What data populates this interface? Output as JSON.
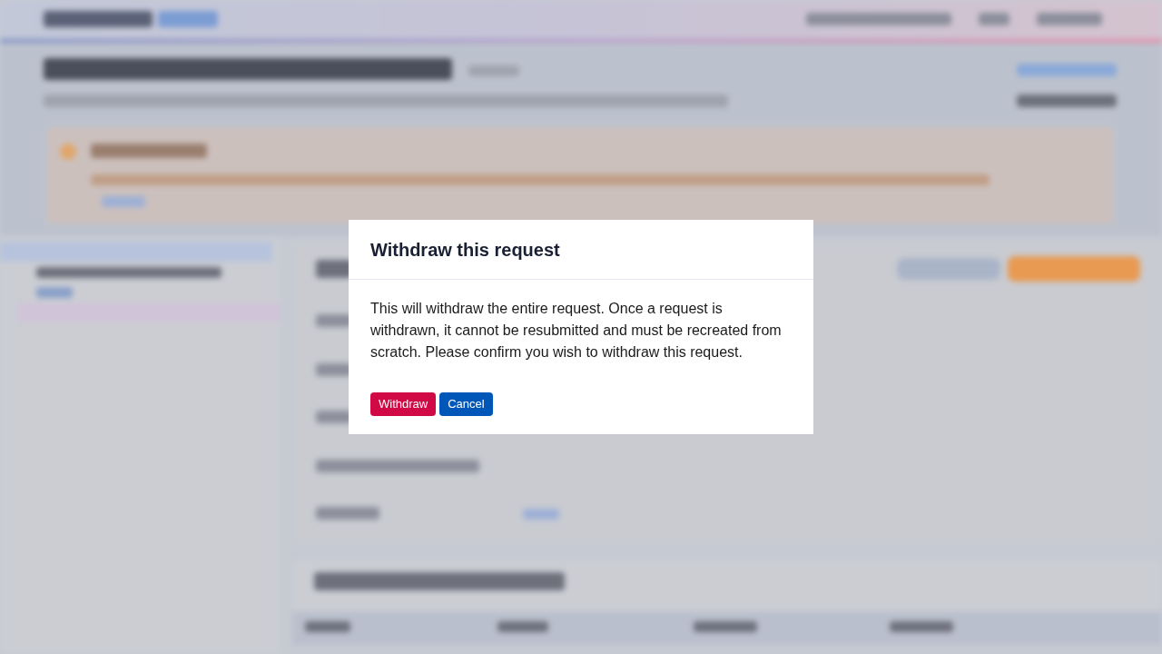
{
  "dialog": {
    "title": "Withdraw this request",
    "message": "This will withdraw the entire request. Once a request is withdrawn, it cannot be resubmitted and must be recreated from scratch. Please confirm you wish to withdraw this request.",
    "buttons": [
      {
        "label": "Withdraw",
        "kind": "danger"
      },
      {
        "label": "Cancel",
        "kind": "primary"
      }
    ]
  }
}
